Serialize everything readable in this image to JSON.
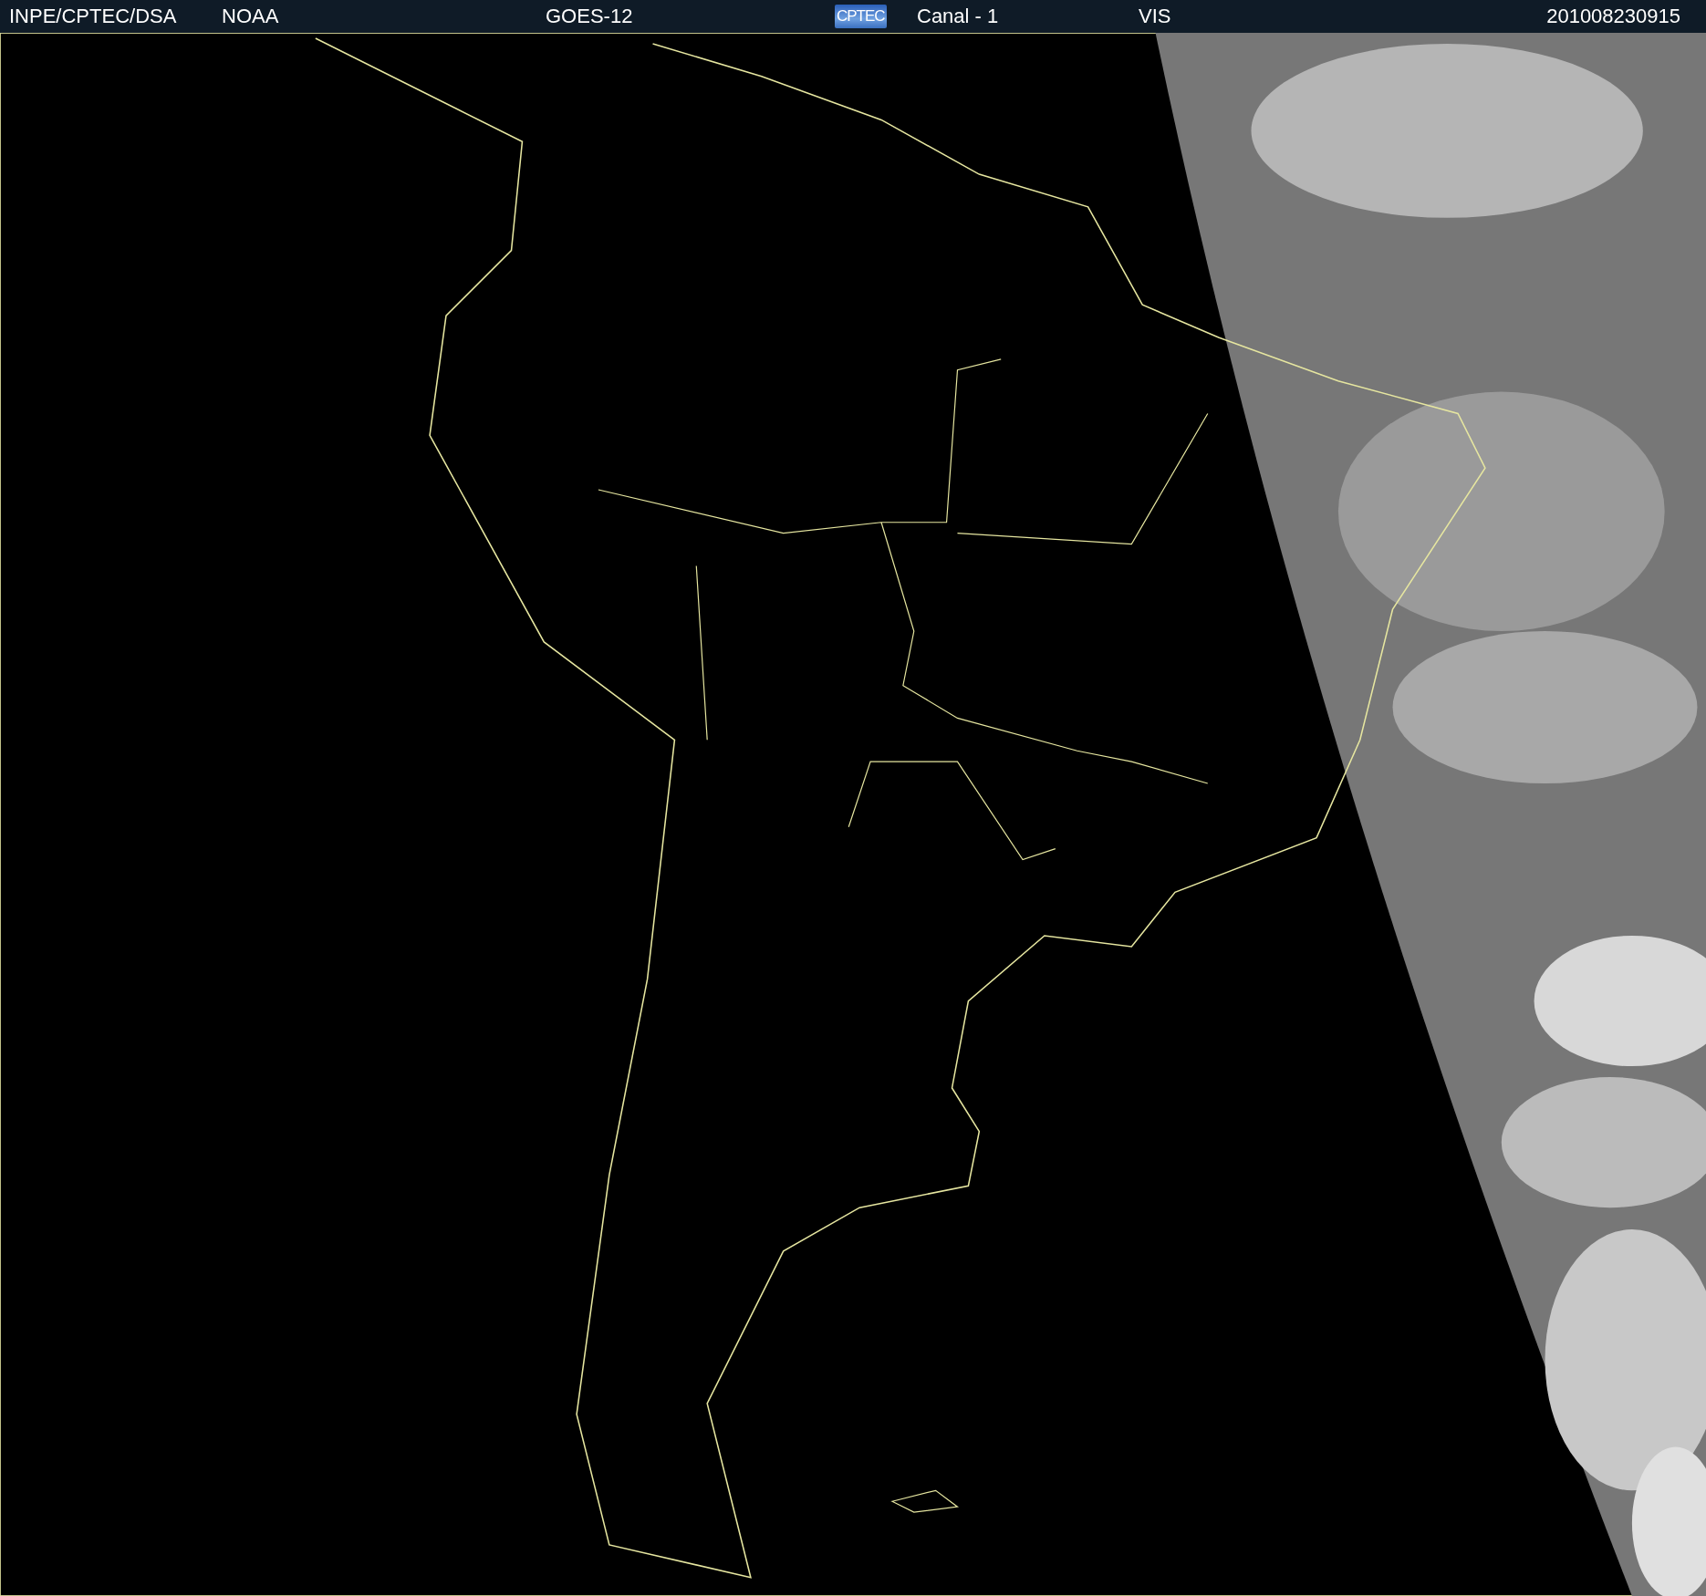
{
  "header": {
    "institution": "INPE/CPTEC/DSA",
    "agency": "NOAA",
    "satellite": "GOES-12",
    "logo": "CPTEC",
    "channel": "Canal - 1",
    "band": "VIS",
    "timestamp": "201008230915"
  }
}
